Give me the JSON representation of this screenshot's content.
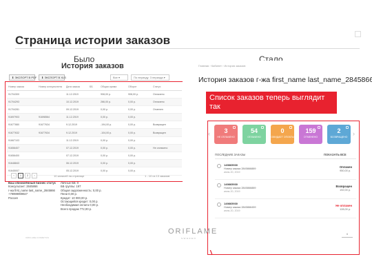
{
  "slide": {
    "title": "Страница истории заказов",
    "before_label": "Было",
    "after_label": "Стало",
    "footer_left": "ORIFLAME COSMETICS",
    "logo": "ORIFLAME",
    "logo_sub": "SWEDEN",
    "page_number": "6"
  },
  "old_page": {
    "heading": "История заказов",
    "toolbar": {
      "export_pdf": "ЭКСПОРТ В PDF",
      "export_xls": "ЭКСПОРТ В XLS",
      "filter_all": "Все",
      "sort_by": "По периоду: 3 периода"
    },
    "columns": [
      "Номер заказа",
      "Номер консультанта",
      "Дата заказа",
      "ББ",
      "Общая сумма",
      "Оборот",
      "Статус"
    ],
    "rows": [
      [
        "91704300",
        "",
        "11.12.2019",
        "",
        "908,00 р.",
        "908,00 р.",
        "Оплачено"
      ],
      [
        "91704293",
        "",
        "10.12.2019",
        "",
        "266,00 р.",
        "0,00 р.",
        "Оплачено"
      ],
      [
        "91704281",
        "",
        "09.12.2019",
        "",
        "0,00 р.",
        "0,00 р.",
        "Отменен"
      ],
      [
        "91697903",
        "91698564",
        "11.12.2019",
        "",
        "0,00 р.",
        "0,00 р.",
        ""
      ],
      [
        "91677880",
        "91677634",
        "9.12.2019",
        "",
        "-194,00 р.",
        "0,00 р.",
        "Возвращен"
      ],
      [
        "91677632",
        "91677634",
        "9.12.2019",
        "",
        "-104,00 р.",
        "0,00 р.",
        "Возвращен"
      ],
      [
        "91667103",
        "",
        "11.12.2019",
        "",
        "0,00 р.",
        "0,00 р.",
        ""
      ],
      [
        "91656407",
        "",
        "07.12.2019",
        "",
        "0,00 р.",
        "0,00 р.",
        "Не оплачено"
      ],
      [
        "91656400",
        "",
        "07.12.2019",
        "",
        "0,00 р.",
        "0,00 р.",
        ""
      ],
      [
        "91648843",
        "",
        "06.12.2019",
        "",
        "0,00 р.",
        "0,00 р.",
        ""
      ],
      [
        "91645007",
        "",
        "05.12.2019",
        "",
        "0,00 р.",
        "0,00 р.",
        ""
      ]
    ],
    "pager": {
      "pages": [
        "‹",
        "1",
        "2",
        "›"
      ],
      "per_page": "10 записей на странице",
      "right": "1 - 10 из 13 заказов"
    },
    "info_left": [
      "Ваш обновлённый бизнес статус",
      "Консультант: 2845866",
      "г-жа first_name last_name_2845866",
      "+79999999927",
      "Россия"
    ],
    "info_right": [
      "Личные ББ: 0",
      "ББ группы: 197",
      "Общая задолженность: 0,00 р.",
      "Пени 0,00 р.",
      "Кредит: 10 000,00 р.",
      "Остающийся кредит: 0,00 р.",
      "Необходимая оплата 0,00 р.",
      "Всего продаж 772,00 р."
    ]
  },
  "new_page": {
    "breadcrumbs": "Главная  ›  Кабинет  ›  История заказов",
    "heading": "История заказов г-жа first_name last_name_2845866",
    "callout": "Список заказов теперь выглядит так",
    "tiles": [
      {
        "count": "3",
        "label": "НЕ ОПЛАЧЕНО",
        "color": "#f07b7b"
      },
      {
        "count": "54",
        "label": "ОПЛАЧЕНО",
        "color": "#7ed3a0"
      },
      {
        "count": "0",
        "label": "ОЖИДАЕТ ОПЛАТЫ",
        "color": "#f4a64d"
      },
      {
        "count": "159",
        "label": "ОТМЕНЕНО",
        "color": "#c977d5"
      },
      {
        "count": "2",
        "label": "ВОЗВРАЩЕНО",
        "color": "#5ea8d6"
      }
    ],
    "orders_heading": "ПОСЛЕДНИЕ ЗАКАЗЫ",
    "show_all": "ПОКАЗАТЬ ВСЕ",
    "orders": [
      {
        "id": "149865930",
        "desc": "Номер заказа 2845866889",
        "date": "июнь 20, 2019",
        "status": "Оплачен",
        "amount": "950,00 р.",
        "danger": false
      },
      {
        "id": "149865930",
        "desc": "Номер заказа 2845866889",
        "date": "июнь 20, 2019",
        "status": "Возвращен",
        "amount": "192,00 р.",
        "danger": false
      },
      {
        "id": "149865930",
        "desc": "Номер заказа 2845866459",
        "date": "июнь 20, 2019",
        "status": "Не оплачен",
        "amount": "128,00 р.",
        "danger": true
      }
    ]
  }
}
